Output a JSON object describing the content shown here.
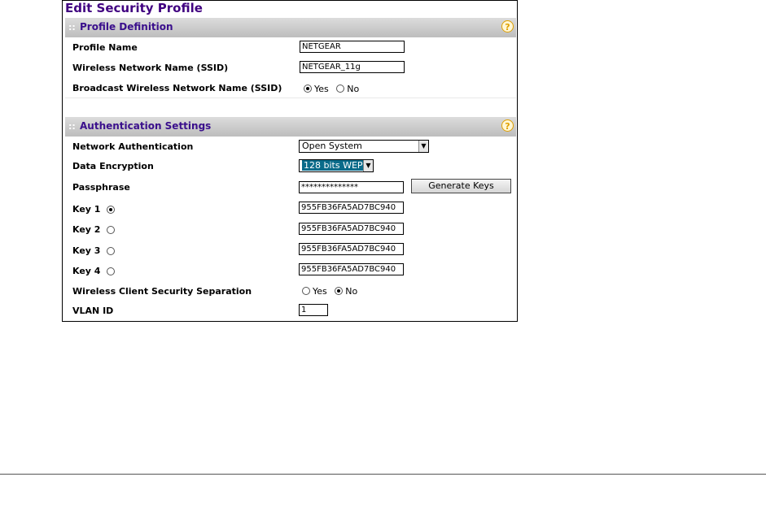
{
  "page_title": "Edit Security Profile",
  "profile_definition": {
    "title": "Profile Definition",
    "help": "?",
    "profile_name": {
      "label": "Profile Name",
      "value": "NETGEAR"
    },
    "ssid": {
      "label": "Wireless Network Name (SSID)",
      "value": "NETGEAR_11g"
    },
    "broadcast": {
      "label": "Broadcast Wireless Network Name (SSID)",
      "yes": "Yes",
      "no": "No",
      "selected": "Yes"
    }
  },
  "authentication": {
    "title": "Authentication Settings",
    "help": "?",
    "network_auth": {
      "label": "Network Authentication",
      "value": "Open System"
    },
    "data_encryption": {
      "label": "Data Encryption",
      "value": "128 bits WEP"
    },
    "passphrase": {
      "label": "Passphrase",
      "value": "**************",
      "button": "Generate Keys"
    },
    "keys": [
      {
        "label": "Key 1",
        "value": "955FB36FA5AD7BC940",
        "selected": true
      },
      {
        "label": "Key 2",
        "value": "955FB36FA5AD7BC940",
        "selected": false
      },
      {
        "label": "Key 3",
        "value": "955FB36FA5AD7BC940",
        "selected": false
      },
      {
        "label": "Key 4",
        "value": "955FB36FA5AD7BC940",
        "selected": false
      }
    ],
    "separation": {
      "label": "Wireless Client Security Separation",
      "yes": "Yes",
      "no": "No",
      "selected": "No"
    },
    "vlan": {
      "label": "VLAN ID",
      "value": "1"
    }
  },
  "colors": {
    "title": "#400080",
    "section_title": "#3a0f8c",
    "help": "#e0a000",
    "select_highlight": "#0a6b8a"
  }
}
